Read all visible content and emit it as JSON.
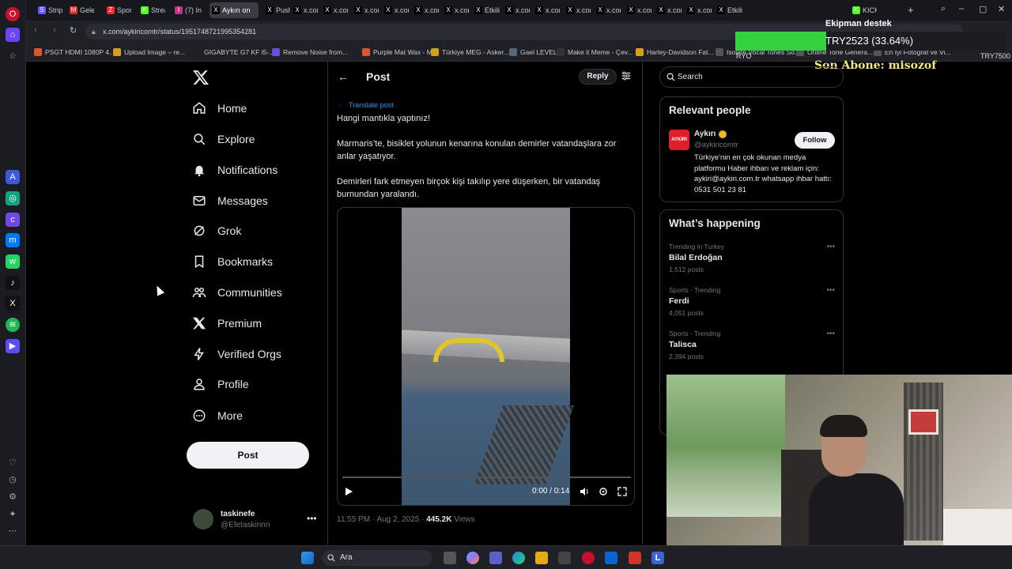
{
  "browser": {
    "tabs": [
      {
        "label": "Strip",
        "fav": "S",
        "color": "#635bff"
      },
      {
        "label": "Geler",
        "fav": "M",
        "color": "#d93025"
      },
      {
        "label": "Spor",
        "fav": "Z",
        "color": "#e4322b"
      },
      {
        "label": "Strea",
        "fav": "K",
        "color": "#53fc18"
      },
      {
        "label": "(7) In",
        "fav": "I",
        "color": "#c13584"
      },
      {
        "label": "Aykırı on",
        "fav": "X",
        "color": "#000000",
        "active": true
      },
      {
        "label": "Push",
        "fav": "X",
        "color": "#000000"
      },
      {
        "label": "x.con",
        "fav": "X",
        "color": "#000000"
      },
      {
        "label": "x.con",
        "fav": "X",
        "color": "#000000"
      },
      {
        "label": "x.con",
        "fav": "X",
        "color": "#000000"
      },
      {
        "label": "x.con",
        "fav": "X",
        "color": "#000000"
      },
      {
        "label": "x.con",
        "fav": "X",
        "color": "#000000"
      },
      {
        "label": "x.con",
        "fav": "X",
        "color": "#000000"
      },
      {
        "label": "Etkili",
        "fav": "X",
        "color": "#000000"
      },
      {
        "label": "x.con",
        "fav": "X",
        "color": "#000000"
      },
      {
        "label": "x.con",
        "fav": "X",
        "color": "#000000"
      },
      {
        "label": "x.con",
        "fav": "X",
        "color": "#000000"
      },
      {
        "label": "x.con",
        "fav": "X",
        "color": "#000000"
      },
      {
        "label": "x.con",
        "fav": "X",
        "color": "#000000"
      },
      {
        "label": "x.con",
        "fav": "X",
        "color": "#000000"
      },
      {
        "label": "x.con",
        "fav": "X",
        "color": "#000000"
      },
      {
        "label": "Etkili",
        "fav": "X",
        "color": "#000000"
      },
      {
        "label": "KICK",
        "fav": "K",
        "color": "#53fc18"
      }
    ],
    "url": "x.com/aykiricomtr/status/1951748721995354281",
    "bookmarks": [
      {
        "label": "PSGT HDMI 1080P 4...",
        "color": "#e0532f"
      },
      {
        "label": "Upload Image – re...",
        "color": "#d4a017"
      },
      {
        "label": "GIGABYTE G7 KF i5-...",
        "color": "#222222"
      },
      {
        "label": "Remove Noise from...",
        "color": "#6b4fd8"
      },
      {
        "label": "Purple Mat Wax - M...",
        "color": "#e0532f"
      },
      {
        "label": "Türkiye MEG - Asker...",
        "color": "#d4a017"
      },
      {
        "label": "Gael LEVEL",
        "color": "#556677"
      },
      {
        "label": "Make it Meme - Çev...",
        "color": "#333333"
      },
      {
        "label": "Harley-Davidson Fat...",
        "color": "#d4a017"
      },
      {
        "label": "Isolate Vocal Tones So...",
        "color": "#555555"
      },
      {
        "label": "Online Tone Genera...",
        "color": "#555555"
      },
      {
        "label": "En İyi Fotoğraf ve Vi...",
        "color": "#555555"
      }
    ]
  },
  "overlay": {
    "goal_title": "Ekipman destek",
    "goal_text": "TRY2523 (33.64%)",
    "goal_fraction": 0.3364,
    "goal_start": "RYO",
    "goal_end": "TRY7500",
    "last_sub": "Son Abone: misozof"
  },
  "nav": {
    "items": [
      {
        "label": "Home",
        "icon": "home-icon"
      },
      {
        "label": "Explore",
        "icon": "search-icon"
      },
      {
        "label": "Notifications",
        "icon": "bell-icon"
      },
      {
        "label": "Messages",
        "icon": "mail-icon"
      },
      {
        "label": "Grok",
        "icon": "grok-icon"
      },
      {
        "label": "Bookmarks",
        "icon": "bookmark-icon"
      },
      {
        "label": "Communities",
        "icon": "people-icon"
      },
      {
        "label": "Premium",
        "icon": "x-icon"
      },
      {
        "label": "Verified Orgs",
        "icon": "lightning-icon"
      },
      {
        "label": "Profile",
        "icon": "person-icon"
      },
      {
        "label": "More",
        "icon": "more-icon"
      }
    ],
    "post_label": "Post",
    "account_name": "taskinefe",
    "account_handle": "@Efetaskinnn"
  },
  "post": {
    "header_title": "Post",
    "reply_label": "Reply",
    "translate": "Translate post",
    "text_1": "Hangi mantıkla yaptınız!",
    "text_2": "Marmaris’te, bisiklet yolunun kenarına konulan demirler vatandaşlara zor anlar yaşatıyor.",
    "text_3": "Demirleri fark etmeyen birçok kişi takılıp yere düşerken, bir vatandaş burnundan yaralandı.",
    "video_time": "0:00 / 0:14",
    "timestamp": "11:55 PM · Aug 2, 2025 · ",
    "views_count": "445.2K",
    "views_label": " Views"
  },
  "right": {
    "search_placeholder": "Search",
    "relevant_title": "Relevant people",
    "rp_name": "Aykırı",
    "rp_handle": "@aykiricomtr",
    "follow_label": "Follow",
    "rp_bio": "Türkiye'nin en çok okunan medya platformu Haber ihbarı ve reklam için: aykiri@aykiri.com.tr whatsapp ihbar hattı: 0531 501 23 81",
    "happening_title": "What’s happening",
    "trends": [
      {
        "context": "Trending in Turkey",
        "name": "Bilal Erdoğan",
        "count": "1,512 posts"
      },
      {
        "context": "Sports · Trending",
        "name": "Ferdi",
        "count": "4,051 posts"
      },
      {
        "context": "Sports · Trending",
        "name": "Talisca",
        "count": "2,394 posts"
      }
    ]
  },
  "taskbar": {
    "search_label": "Ara"
  }
}
